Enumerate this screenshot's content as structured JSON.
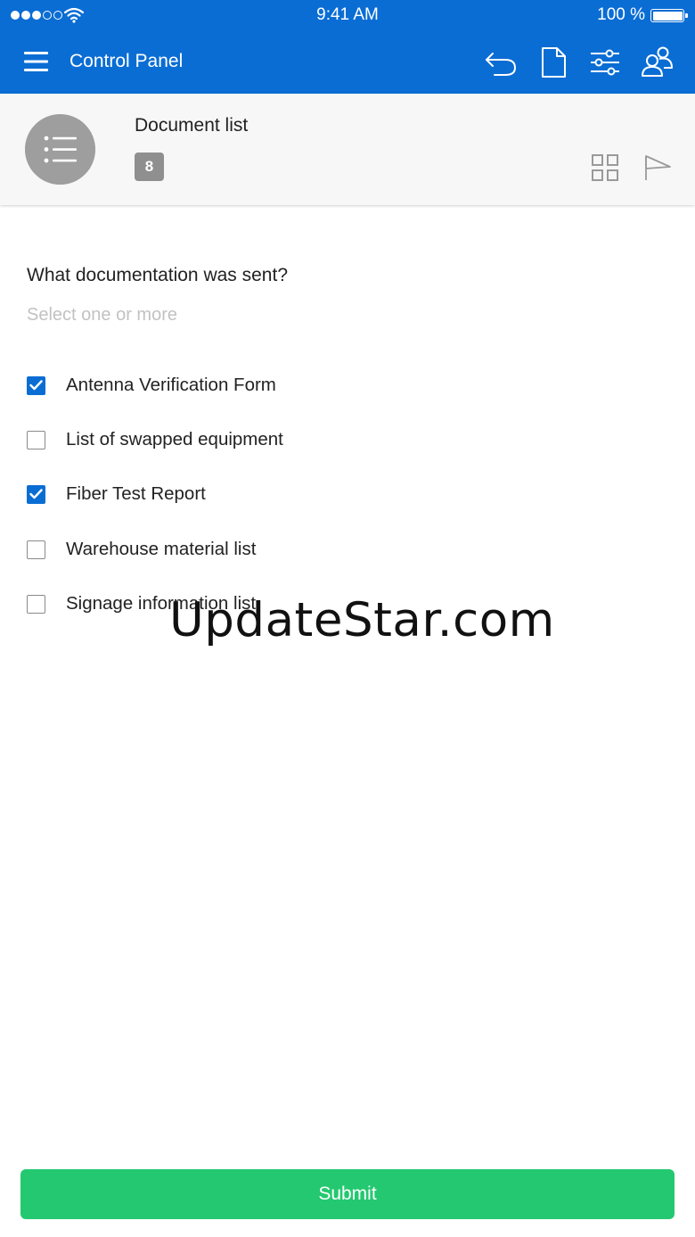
{
  "status_bar": {
    "time": "9:41 AM",
    "battery": "100 %"
  },
  "header": {
    "title": "Control Panel",
    "accent_color": "#0a6dd4",
    "icons": [
      "menu-icon",
      "undo-icon",
      "document-icon",
      "sliders-icon",
      "users-icon"
    ]
  },
  "document": {
    "title": "Document list",
    "count": "8",
    "icons": [
      "list-icon",
      "grid-icon",
      "flag-icon"
    ]
  },
  "form": {
    "question": "What documentation was sent?",
    "helper": "Select one or more",
    "options": [
      {
        "label": "Antenna Verification Form",
        "checked": true
      },
      {
        "label": "List of swapped equipment",
        "checked": false
      },
      {
        "label": "Fiber Test Report",
        "checked": true
      },
      {
        "label": "Warehouse material list",
        "checked": false
      },
      {
        "label": "Signage information list",
        "checked": false
      }
    ]
  },
  "watermark": "UpdateStar.com",
  "submit": {
    "label": "Submit",
    "color": "#24c870"
  }
}
